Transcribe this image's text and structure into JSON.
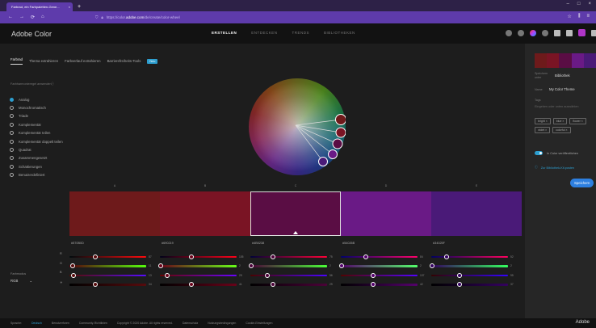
{
  "browser": {
    "tab_title": "Farbrad, ein Farbpaletten-Gene...",
    "tab_close": "×",
    "new_tab": "+",
    "url_prefix": "https://color.",
    "url_domain": "adobe.com",
    "url_path": "/de/create/color-wheel",
    "nav": [
      "←",
      "→",
      "⟳",
      "⌂"
    ],
    "window_controls": [
      "–",
      "□",
      "×"
    ]
  },
  "header": {
    "logo": "Adobe Color",
    "nav": [
      {
        "label": "ERSTELLEN",
        "active": true
      },
      {
        "label": "ENTDECKEN",
        "active": false
      },
      {
        "label": "TRENDS",
        "active": false
      },
      {
        "label": "BIBLIOTHEKEN",
        "active": false
      }
    ]
  },
  "subtabs": [
    {
      "label": "Farbrad",
      "active": true
    },
    {
      "label": "Thema extrahieren",
      "active": false
    },
    {
      "label": "Farbverlauf extrahieren",
      "active": false
    },
    {
      "label": "Barrierefreiheits-Tools",
      "active": false
    }
  ],
  "new_badge": "Neu",
  "harmony": {
    "heading": "Farbharmonieregel anwenden",
    "help": "ⓘ",
    "rules": [
      {
        "label": "Analog",
        "selected": true
      },
      {
        "label": "Monochromatisch",
        "selected": false
      },
      {
        "label": "Triade",
        "selected": false
      },
      {
        "label": "Komplementär",
        "selected": false
      },
      {
        "label": "Komplementär teilen",
        "selected": false
      },
      {
        "label": "Komplementär doppelt teilen",
        "selected": false
      },
      {
        "label": "Quadrat",
        "selected": false
      },
      {
        "label": "Zusammengesetzt",
        "selected": false
      },
      {
        "label": "Schattierungen",
        "selected": false
      },
      {
        "label": "Benutzerdefiniert",
        "selected": false
      }
    ]
  },
  "swatches": [
    {
      "letter": "A",
      "hex": "#570B0D",
      "color": "#6e1a1b"
    },
    {
      "letter": "B",
      "hex": "#690219",
      "color": "#7a1424"
    },
    {
      "letter": "C",
      "hex": "#4B0238",
      "color": "#5a0d44",
      "selected": true
    },
    {
      "letter": "D",
      "hex": "#54026B",
      "color": "#6a1a86"
    },
    {
      "letter": "E",
      "hex": "#34025F",
      "color": "#4a1a78"
    }
  ],
  "channels": [
    "R",
    "G",
    "B",
    "☀"
  ],
  "values": [
    [
      87,
      11,
      13,
      34
    ],
    [
      105,
      2,
      25,
      41
    ],
    [
      75,
      2,
      56,
      29
    ],
    [
      84,
      2,
      107,
      42
    ],
    [
      52,
      2,
      95,
      37
    ]
  ],
  "color_mode": {
    "label": "Farbmodus",
    "value": "RGB",
    "caret": "⌄"
  },
  "sidebar": {
    "save_to_label": "Speichern unter",
    "save_to_value": "Bibliothek",
    "name_label": "Name",
    "name_value": "My Color Theme",
    "tags_label": "Tags",
    "tags_placeholder": "Eingeben oder unten auswählen",
    "chips": [
      "bright ×",
      "blue ×",
      "flower ×",
      "violet ×",
      "colorful ×"
    ],
    "publish_label": "In Color veröffentlichen",
    "cc_link": "Zur Bibliothek-Kit.posten",
    "save_button": "Speichern",
    "palette": [
      "#6e1a1b",
      "#7a1424",
      "#5a0d44",
      "#6a1a86",
      "#4a1a78"
    ]
  },
  "footer": {
    "items": [
      "Sprache:",
      "Deutsch",
      "Benutzerforen",
      "Community-Richtlinien",
      "Copyright © 2020 Adobe. All rights reserved.",
      "Datenschutz",
      "Nutzungsbedingungen",
      "Cookie-Einstellungen"
    ],
    "logo": "Adobe"
  }
}
